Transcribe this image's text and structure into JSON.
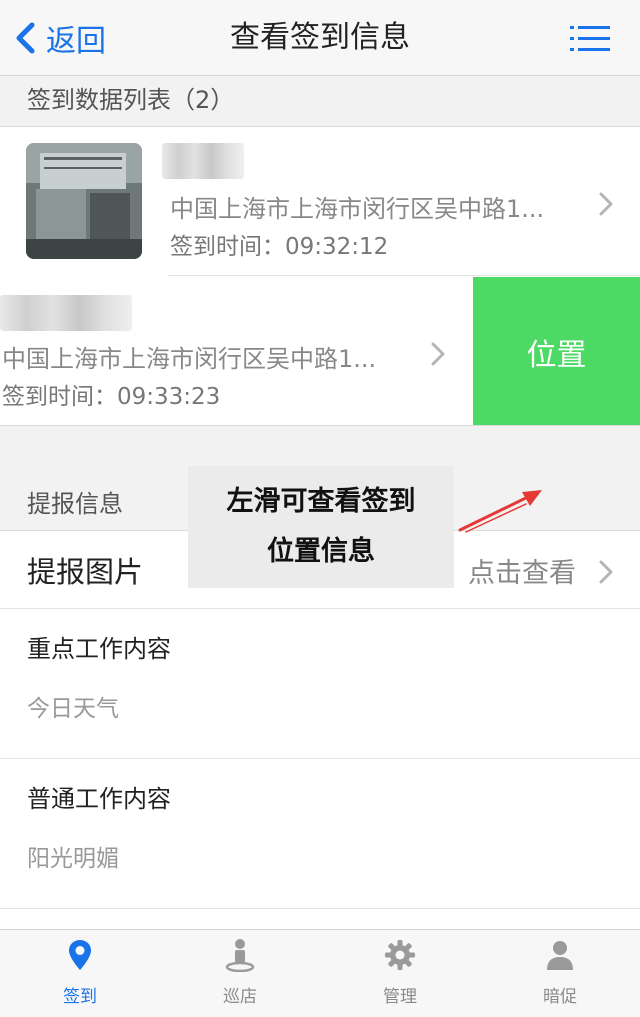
{
  "nav": {
    "back_label": "返回",
    "title": "查看签到信息"
  },
  "signin_list": {
    "header": "签到数据列表（2）",
    "items": [
      {
        "address": "中国上海市上海市闵行区吴中路1...",
        "time_label": "签到时间：09:32:12"
      },
      {
        "address": "中国上海市上海市闵行区吴中路1...",
        "time_label": "签到时间：09:33:23",
        "swipe_action": "位置"
      }
    ]
  },
  "report": {
    "header": "提报信息",
    "picture_label": "提报图片",
    "picture_action": "点击查看",
    "key_work_title": "重点工作内容",
    "key_work_value": "今日天气",
    "normal_work_title": "普通工作内容",
    "normal_work_value": "阳光明媚"
  },
  "tip": {
    "line1": "左滑可查看签到",
    "line2": "位置信息"
  },
  "tabs": [
    {
      "label": "签到",
      "icon": "location-pin-icon",
      "active": true
    },
    {
      "label": "巡店",
      "icon": "person-pin-icon",
      "active": false
    },
    {
      "label": "管理",
      "icon": "gear-icon",
      "active": false
    },
    {
      "label": "暗促",
      "icon": "user-icon",
      "active": false
    }
  ],
  "colors": {
    "accent": "#1a73e8",
    "swipe_green": "#4cd964",
    "tip_arrow_red": "#e53935"
  }
}
